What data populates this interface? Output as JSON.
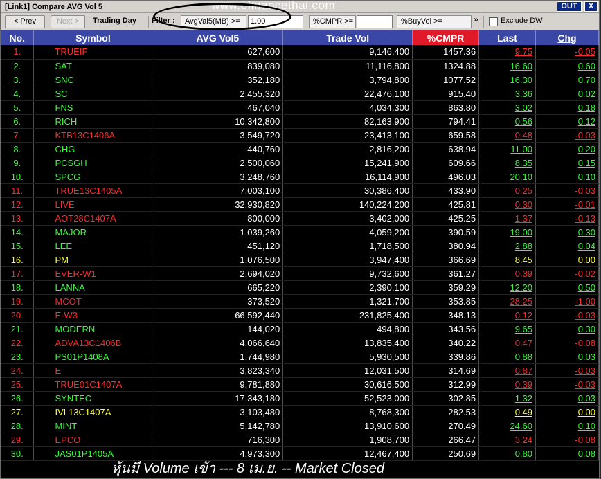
{
  "window": {
    "title": "[Link1] Compare AVG Vol 5",
    "out_label": "OUT",
    "close_label": "X"
  },
  "toolbar": {
    "prev_label": "< Prev",
    "next_label": "Next >",
    "trading_day_label": "Trading Day",
    "filter_label": "Filter :",
    "avg_label": "AvgVal5(MB) >=",
    "avg_value": "1.00",
    "cmpr_label": "%CMPR >=",
    "cmpr_value": "",
    "buyvol_label": "%BuyVol >=",
    "more_symbol": "»",
    "exclude_dw_label": "Exclude DW",
    "exclude_dw_checked": false
  },
  "watermark": "www.efinancethai.com",
  "table": {
    "headers": [
      "No.",
      "Symbol",
      "AVG Vol5",
      "Trade Vol",
      "%CMPR",
      "Last",
      "Chg"
    ],
    "rows": [
      {
        "no": "1.",
        "symbol": "TRUEIF",
        "avg": "627,600",
        "vol": "9,146,400",
        "cmpr": "1457.36",
        "last": "9.75",
        "chg": "-0.05",
        "color": "#ff2a2a"
      },
      {
        "no": "2.",
        "symbol": "SAT",
        "avg": "839,080",
        "vol": "11,116,800",
        "cmpr": "1324.88",
        "last": "16.60",
        "chg": "0.60",
        "color": "#33ff33"
      },
      {
        "no": "3.",
        "symbol": "SNC",
        "avg": "352,180",
        "vol": "3,794,800",
        "cmpr": "1077.52",
        "last": "16.30",
        "chg": "0.70",
        "color": "#33ff33"
      },
      {
        "no": "4.",
        "symbol": "SC",
        "avg": "2,455,320",
        "vol": "22,476,100",
        "cmpr": "915.40",
        "last": "3.36",
        "chg": "0.02",
        "color": "#33ff33"
      },
      {
        "no": "5.",
        "symbol": "FNS",
        "avg": "467,040",
        "vol": "4,034,300",
        "cmpr": "863.80",
        "last": "3.02",
        "chg": "0.18",
        "color": "#33ff33"
      },
      {
        "no": "6.",
        "symbol": "RICH",
        "avg": "10,342,800",
        "vol": "82,163,900",
        "cmpr": "794.41",
        "last": "0.56",
        "chg": "0.12",
        "color": "#33ff33"
      },
      {
        "no": "7.",
        "symbol": "KTB13C1406A",
        "avg": "3,549,720",
        "vol": "23,413,100",
        "cmpr": "659.58",
        "last": "0.48",
        "chg": "-0.03",
        "color": "#ff2a2a"
      },
      {
        "no": "8.",
        "symbol": "CHG",
        "avg": "440,760",
        "vol": "2,816,200",
        "cmpr": "638.94",
        "last": "11.00",
        "chg": "0.20",
        "color": "#33ff33"
      },
      {
        "no": "9.",
        "symbol": "PCSGH",
        "avg": "2,500,060",
        "vol": "15,241,900",
        "cmpr": "609.66",
        "last": "8.35",
        "chg": "0.15",
        "color": "#33ff33"
      },
      {
        "no": "10.",
        "symbol": "SPCG",
        "avg": "3,248,760",
        "vol": "16,114,900",
        "cmpr": "496.03",
        "last": "20.10",
        "chg": "0.10",
        "color": "#33ff33"
      },
      {
        "no": "11.",
        "symbol": "TRUE13C1405A",
        "avg": "7,003,100",
        "vol": "30,386,400",
        "cmpr": "433.90",
        "last": "0.25",
        "chg": "-0.03",
        "color": "#ff2a2a"
      },
      {
        "no": "12.",
        "symbol": "LIVE",
        "avg": "32,930,820",
        "vol": "140,224,200",
        "cmpr": "425.81",
        "last": "0.30",
        "chg": "-0.01",
        "color": "#ff2a2a"
      },
      {
        "no": "13.",
        "symbol": "AOT28C1407A",
        "avg": "800,000",
        "vol": "3,402,000",
        "cmpr": "425.25",
        "last": "1.37",
        "chg": "-0.13",
        "color": "#ff2a2a"
      },
      {
        "no": "14.",
        "symbol": "MAJOR",
        "avg": "1,039,260",
        "vol": "4,059,200",
        "cmpr": "390.59",
        "last": "19.00",
        "chg": "0.30",
        "color": "#33ff33"
      },
      {
        "no": "15.",
        "symbol": "LEE",
        "avg": "451,120",
        "vol": "1,718,500",
        "cmpr": "380.94",
        "last": "2.88",
        "chg": "0.04",
        "color": "#33ff33"
      },
      {
        "no": "16.",
        "symbol": "PM",
        "avg": "1,076,500",
        "vol": "3,947,400",
        "cmpr": "366.69",
        "last": "8.45",
        "chg": "0.00",
        "color": "#ffff33"
      },
      {
        "no": "17.",
        "symbol": "EVER-W1",
        "avg": "2,694,020",
        "vol": "9,732,600",
        "cmpr": "361.27",
        "last": "0.39",
        "chg": "-0.02",
        "color": "#ff2a2a"
      },
      {
        "no": "18.",
        "symbol": "LANNA",
        "avg": "665,220",
        "vol": "2,390,100",
        "cmpr": "359.29",
        "last": "12.20",
        "chg": "0.50",
        "color": "#33ff33"
      },
      {
        "no": "19.",
        "symbol": "MCOT",
        "avg": "373,520",
        "vol": "1,321,700",
        "cmpr": "353.85",
        "last": "28.25",
        "chg": "-1.00",
        "color": "#ff2a2a"
      },
      {
        "no": "20.",
        "symbol": "E-W3",
        "avg": "66,592,440",
        "vol": "231,825,400",
        "cmpr": "348.13",
        "last": "0.12",
        "chg": "-0.03",
        "color": "#ff2a2a"
      },
      {
        "no": "21.",
        "symbol": "MODERN",
        "avg": "144,020",
        "vol": "494,800",
        "cmpr": "343.56",
        "last": "9.65",
        "chg": "0.30",
        "color": "#33ff33"
      },
      {
        "no": "22.",
        "symbol": "ADVA13C1406B",
        "avg": "4,066,640",
        "vol": "13,835,400",
        "cmpr": "340.22",
        "last": "0.47",
        "chg": "-0.08",
        "color": "#ff2a2a"
      },
      {
        "no": "23.",
        "symbol": "PS01P1408A",
        "avg": "1,744,980",
        "vol": "5,930,500",
        "cmpr": "339.86",
        "last": "0.88",
        "chg": "0.03",
        "color": "#33ff33"
      },
      {
        "no": "24.",
        "symbol": "E",
        "avg": "3,823,340",
        "vol": "12,031,500",
        "cmpr": "314.69",
        "last": "0.87",
        "chg": "-0.03",
        "color": "#ff2a2a"
      },
      {
        "no": "25.",
        "symbol": "TRUE01C1407A",
        "avg": "9,781,880",
        "vol": "30,616,500",
        "cmpr": "312.99",
        "last": "0.39",
        "chg": "-0.03",
        "color": "#ff2a2a"
      },
      {
        "no": "26.",
        "symbol": "SYNTEC",
        "avg": "17,343,180",
        "vol": "52,523,000",
        "cmpr": "302.85",
        "last": "1.32",
        "chg": "0.03",
        "color": "#33ff33"
      },
      {
        "no": "27.",
        "symbol": "IVL13C1407A",
        "avg": "3,103,480",
        "vol": "8,768,300",
        "cmpr": "282.53",
        "last": "0.49",
        "chg": "0.00",
        "color": "#ffff33"
      },
      {
        "no": "28.",
        "symbol": "MINT",
        "avg": "5,142,780",
        "vol": "13,910,600",
        "cmpr": "270.49",
        "last": "24.60",
        "chg": "0.10",
        "color": "#33ff33"
      },
      {
        "no": "29.",
        "symbol": "EPCO",
        "avg": "716,300",
        "vol": "1,908,700",
        "cmpr": "266.47",
        "last": "3.24",
        "chg": "-0.08",
        "color": "#ff2a2a"
      },
      {
        "no": "30.",
        "symbol": "JAS01P1405A",
        "avg": "4,973,300",
        "vol": "12,467,400",
        "cmpr": "250.69",
        "last": "0.80",
        "chg": "0.08",
        "color": "#33ff33"
      }
    ]
  },
  "footer_caption": "หุ้นมี Volume เข้า --- 8 เม.ย. -- Market Closed"
}
